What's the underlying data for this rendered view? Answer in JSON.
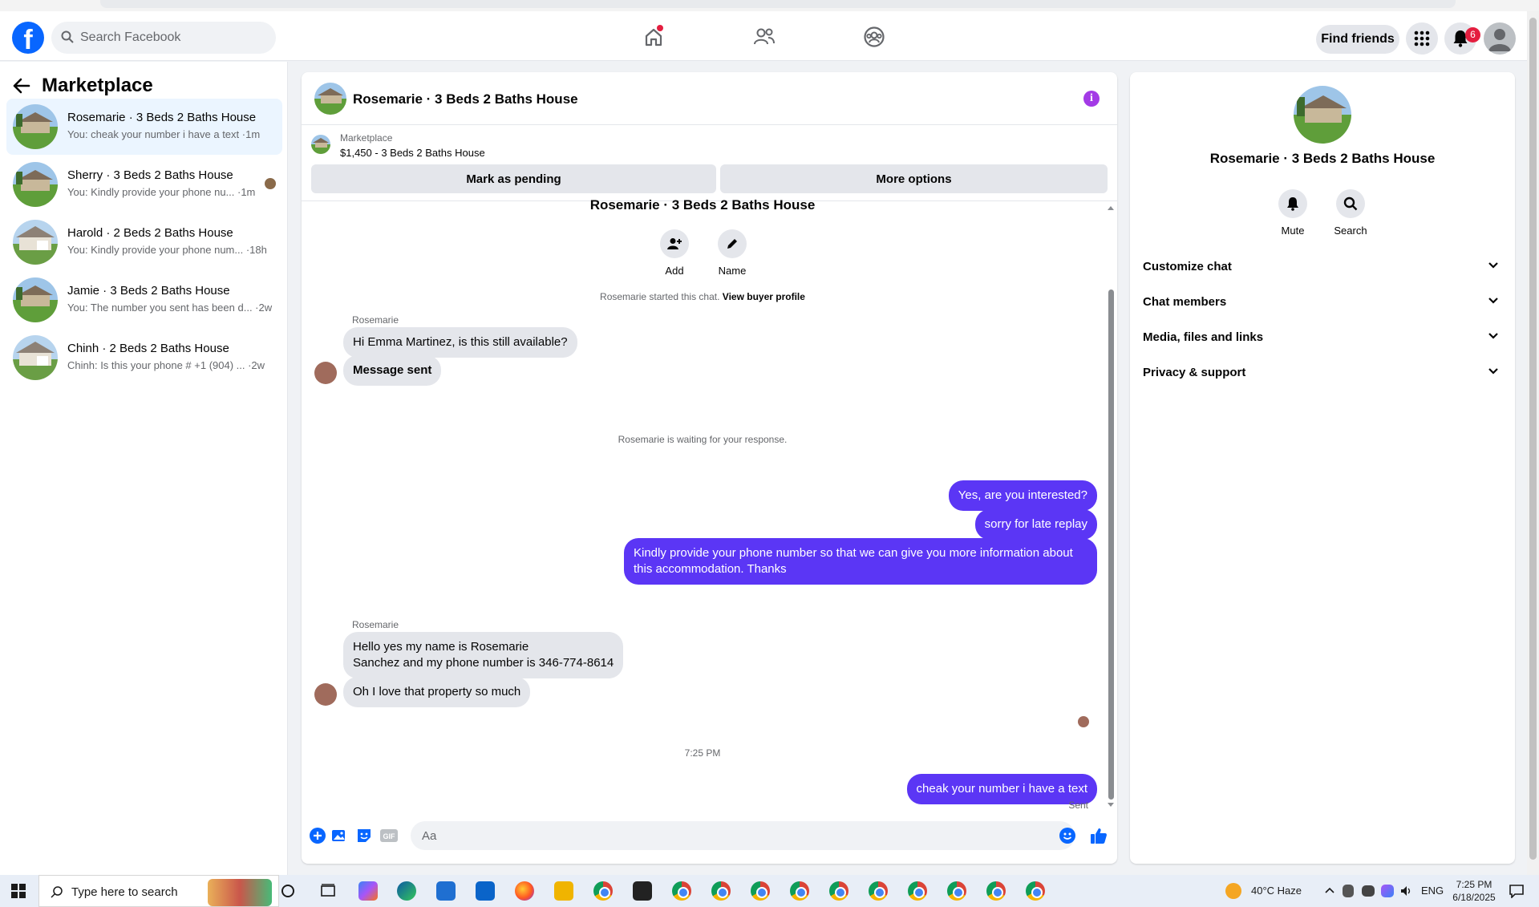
{
  "header": {
    "search_placeholder": "Search Facebook",
    "find_friends_label": "Find friends",
    "notification_count": "6"
  },
  "sidebar": {
    "title": "Marketplace",
    "conversations": [
      {
        "title": "Rosemarie · 3 Beds 2 Baths House",
        "preview": "You: cheak your number i have a text ·1m",
        "active": true
      },
      {
        "title": "Sherry · 3 Beds 2 Baths House",
        "preview": "You: Kindly provide your phone nu... ·1m",
        "active": false
      },
      {
        "title": "Harold · 2 Beds 2 Baths House",
        "preview": "You: Kindly provide your phone num... ·18h",
        "active": false
      },
      {
        "title": "Jamie · 3 Beds 2 Baths House",
        "preview": "You: The number you sent has been d... ·2w",
        "active": false
      },
      {
        "title": "Chinh · 2 Beds 2 Baths House",
        "preview": "Chinh: Is this your phone # +1 (904) ... ·2w",
        "active": false
      }
    ]
  },
  "chat": {
    "title": "Rosemarie · 3 Beds 2 Baths House",
    "listing_source": "Marketplace",
    "listing_price": "$1,450 - 3 Beds 2 Baths House",
    "mark_pending_label": "Mark as pending",
    "more_options_label": "More options",
    "center_name": "Rosemarie · 3 Beds 2 Baths House",
    "add_label": "Add",
    "name_label": "Name",
    "started_text": "Rosemarie started this chat.",
    "view_profile_link": "View buyer profile",
    "sender_name_1": "Rosemarie",
    "msg_in_1": "Hi Emma Martinez, is this still available?",
    "msg_in_2": "Message sent",
    "waiting_text": "Rosemarie is waiting for your response.",
    "msg_out_1": "Yes, are you interested?",
    "msg_out_2": "sorry for late replay",
    "msg_out_3": "Kindly provide your phone number so that we can give you more information about\nthis accommodation. Thanks",
    "sender_name_2": "Rosemarie",
    "msg_in_3": "Hello yes my name is Rosemarie\nSanchez and my phone number is 346-774-8614",
    "msg_in_4": "Oh I love that property so much",
    "timestamp": "7:25 PM",
    "msg_out_4": "cheak your number i have a text",
    "sent_status": "Sent",
    "composer_placeholder": "Aa"
  },
  "right_panel": {
    "name": "Rosemarie · 3 Beds 2 Baths House",
    "mute_label": "Mute",
    "search_label": "Search",
    "sections": [
      "Customize chat",
      "Chat members",
      "Media, files and links",
      "Privacy & support"
    ]
  },
  "taskbar": {
    "search_label": "Type here to search",
    "weather": "40°C  Haze",
    "language": "ENG",
    "time": "7:25 PM",
    "date": "6/18/2025"
  },
  "colors": {
    "fb_blue": "#0866ff",
    "outgoing_bubble": "#5b36f5",
    "incoming_bubble": "#e4e6eb",
    "notification_red": "#e41e3f",
    "info_purple": "#a33ae6"
  }
}
